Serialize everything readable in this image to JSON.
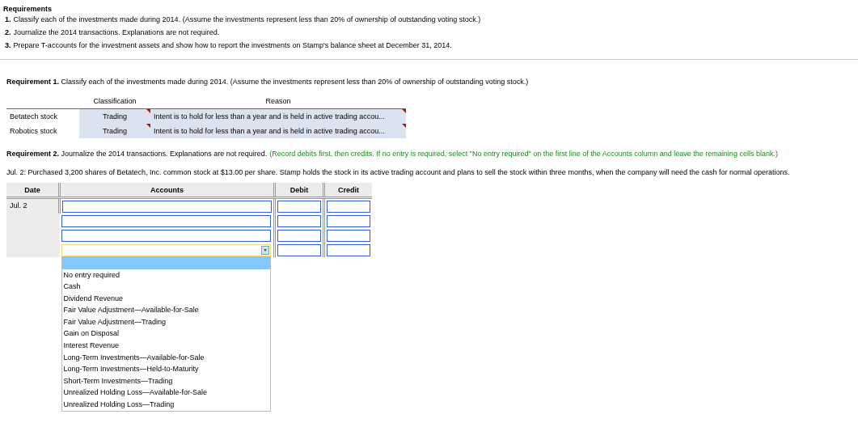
{
  "requirements": {
    "title": "Requirements",
    "items": [
      {
        "number": "1.",
        "text": "Classify each of the investments made during 2014. (Assume the investments represent less than 20% of ownership of outstanding voting stock.)"
      },
      {
        "number": "2.",
        "text": "Journalize the 2014 transactions. Explanations are not required."
      },
      {
        "number": "3.",
        "text": "Prepare T-accounts for the investment assets and show how to report the investments on Stamp's balance sheet at December 31, 2014."
      }
    ]
  },
  "requirement_1": {
    "text": "**Requirement 1.** Classify each of the investments made during 2014. (Assume the investments represent less than 20% of ownership of outstanding voting stock.)"
  },
  "classification_table": {
    "columns": [
      "Classification",
      "Reason"
    ],
    "rows": [
      {
        "name": "Betatech stock",
        "classification": "Trading",
        "reason": "Intent is to hold for less than a year and is held in active trading accou..."
      },
      {
        "name": "Robotics stock",
        "classification": "Trading",
        "reason": "Intent is to hold for less than a year and is held in active trading accou..."
      }
    ]
  },
  "requirement_2": {
    "text": "**Requirement 2.** Journalize the 2014 transactions. Explanations are not required.",
    "instruction": "(Record debits first, then credits. If no entry is required, select \"No entry required\" on the first line of the Accounts column and leave the remaining cells blank.)"
  },
  "transaction": "Jul. 2: Purchased 3,200 shares of Betatech, Inc. common stock at $13.00 per share. Stamp holds the stock in its active trading account and plans to sell the stock within three months, when the company will need the cash for normal operations.",
  "journal": {
    "columns": [
      "Date",
      "Accounts",
      "Debit",
      "Credit"
    ],
    "date": "Jul. 2",
    "rows": [
      {
        "kind": "text",
        "focused": false
      },
      {
        "kind": "text",
        "focused": false
      },
      {
        "kind": "text",
        "focused": false
      },
      {
        "kind": "select",
        "focused": true,
        "open": true
      }
    ],
    "options": [
      "No entry required",
      "Cash",
      "Dividend Revenue",
      "Fair Value Adjustment—Available-for-Sale",
      "Fair Value Adjustment—Trading",
      "Gain on Disposal",
      "Interest Revenue",
      "Long-Term Investments—Available-for-Sale",
      "Long-Term Investments—Held-to-Maturity",
      "Short-Term Investments—Trading",
      "Unrealized Holding Loss—Available-for-Sale",
      "Unrealized Holding Loss—Trading"
    ]
  }
}
